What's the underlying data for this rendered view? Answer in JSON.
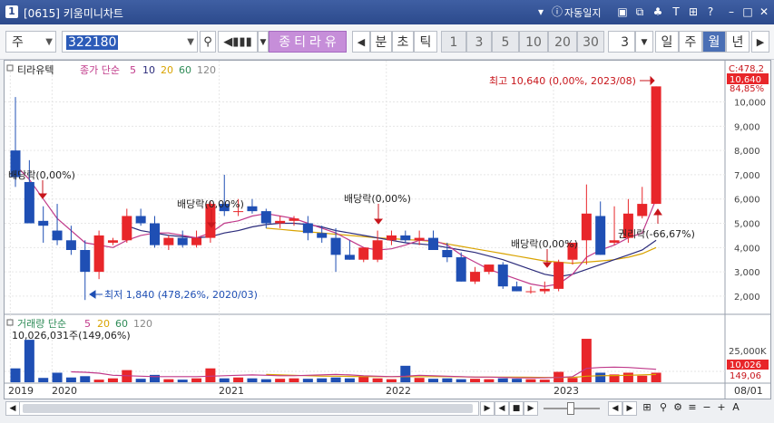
{
  "window": {
    "code": "[0615]",
    "title": "키움미니차트",
    "auto_log": "자동일지",
    "num_badge": "1"
  },
  "toolbar": {
    "market": "주",
    "code": "322180",
    "name_chars": [
      "티",
      "라",
      "유"
    ],
    "name_prefix": "종",
    "period_buttons": [
      "분",
      "초",
      "틱"
    ],
    "interval_buttons": [
      "1",
      "3",
      "5",
      "10",
      "20",
      "30"
    ],
    "interval_value": "3",
    "cycle_buttons": [
      "일",
      "주",
      "월",
      "년"
    ],
    "selected_cycle": "월"
  },
  "legend": {
    "stock_name": "티라유텍",
    "ma_label": "종가 단순",
    "ma_periods": [
      {
        "label": "5",
        "color": "#c0398a"
      },
      {
        "label": "10",
        "color": "#2a2a7a"
      },
      {
        "label": "20",
        "color": "#d9a300"
      },
      {
        "label": "60",
        "color": "#2e8b57"
      },
      {
        "label": "120",
        "color": "#888888"
      }
    ],
    "vol_label": "거래량 단순",
    "vol_periods": [
      {
        "label": "5",
        "color": "#c0398a"
      },
      {
        "label": "20",
        "color": "#d9a300"
      },
      {
        "label": "60",
        "color": "#2e8b57"
      },
      {
        "label": "120",
        "color": "#888888"
      }
    ],
    "vol_max_text": "10,026,031주(149,06%)"
  },
  "annotations": {
    "high": "최고 10,640 (0,00%, 2023/08)",
    "low": "최저 1,840 (478,26%, 2020/03)",
    "dividends": [
      "배당락(0,00%)",
      "배당락(0,00%)",
      "배당락(0,00%)",
      "배당락(0,00%)"
    ],
    "rights": "권리락(-66,67%)"
  },
  "price_axis": {
    "ticks": [
      "10,000",
      "9,000",
      "8,000",
      "7,000",
      "6,000",
      "5,000",
      "4,000",
      "3,000",
      "2,000"
    ],
    "current_badge": "10,640",
    "top_badge": "C:478,2",
    "second_badge": "84,85%"
  },
  "volume_axis": {
    "tick": "25,000K",
    "badge1": "10,026",
    "badge2": "149,06"
  },
  "time_axis": {
    "labels": [
      "2019",
      "2020",
      "2021",
      "2022",
      "2023"
    ],
    "right_label": "08/01"
  },
  "chart_data": {
    "type": "candlestick",
    "title": "티라유텍",
    "x_unit": "month",
    "y_range": [
      1400,
      11400
    ],
    "candles": [
      {
        "o": 8000,
        "h": 10200,
        "l": 6500,
        "c": 6900
      },
      {
        "o": 6700,
        "h": 7600,
        "l": 5300,
        "c": 5000
      },
      {
        "o": 5100,
        "h": 5700,
        "l": 4200,
        "c": 4900
      },
      {
        "o": 4700,
        "h": 5800,
        "l": 4100,
        "c": 4300
      },
      {
        "o": 4300,
        "h": 4900,
        "l": 3700,
        "c": 3900
      },
      {
        "o": 3900,
        "h": 4300,
        "l": 1840,
        "c": 3000
      },
      {
        "o": 3000,
        "h": 4700,
        "l": 2700,
        "c": 4500
      },
      {
        "o": 4200,
        "h": 4400,
        "l": 4100,
        "c": 4300
      },
      {
        "o": 4300,
        "h": 5600,
        "l": 4200,
        "c": 5300
      },
      {
        "o": 5300,
        "h": 5600,
        "l": 4900,
        "c": 5000
      },
      {
        "o": 5000,
        "h": 5300,
        "l": 4000,
        "c": 4100
      },
      {
        "o": 4100,
        "h": 4500,
        "l": 3900,
        "c": 4400
      },
      {
        "o": 4400,
        "h": 4700,
        "l": 4000,
        "c": 4100
      },
      {
        "o": 4100,
        "h": 4700,
        "l": 4000,
        "c": 4400
      },
      {
        "o": 4400,
        "h": 5900,
        "l": 4200,
        "c": 5800
      },
      {
        "o": 5800,
        "h": 7000,
        "l": 5300,
        "c": 5500
      },
      {
        "o": 5500,
        "h": 6000,
        "l": 5300,
        "c": 5500
      },
      {
        "o": 5700,
        "h": 6000,
        "l": 5400,
        "c": 5500
      },
      {
        "o": 5500,
        "h": 5600,
        "l": 4800,
        "c": 5000
      },
      {
        "o": 5000,
        "h": 5300,
        "l": 4800,
        "c": 5100
      },
      {
        "o": 5100,
        "h": 5300,
        "l": 4900,
        "c": 5200
      },
      {
        "o": 5000,
        "h": 5300,
        "l": 4300,
        "c": 4600
      },
      {
        "o": 4600,
        "h": 4900,
        "l": 4200,
        "c": 4400
      },
      {
        "o": 4400,
        "h": 4800,
        "l": 3000,
        "c": 3700
      },
      {
        "o": 3700,
        "h": 4300,
        "l": 3500,
        "c": 3500
      },
      {
        "o": 3500,
        "h": 4000,
        "l": 3400,
        "c": 4000
      },
      {
        "o": 3500,
        "h": 4700,
        "l": 3400,
        "c": 4300
      },
      {
        "o": 4300,
        "h": 4700,
        "l": 4100,
        "c": 4500
      },
      {
        "o": 4500,
        "h": 4700,
        "l": 4200,
        "c": 4300
      },
      {
        "o": 4300,
        "h": 4700,
        "l": 4100,
        "c": 4400
      },
      {
        "o": 4400,
        "h": 4700,
        "l": 3900,
        "c": 3900
      },
      {
        "o": 3900,
        "h": 4200,
        "l": 3400,
        "c": 3600
      },
      {
        "o": 3600,
        "h": 3800,
        "l": 2600,
        "c": 2600
      },
      {
        "o": 2600,
        "h": 3200,
        "l": 2500,
        "c": 3000
      },
      {
        "o": 3000,
        "h": 3300,
        "l": 2900,
        "c": 3300
      },
      {
        "o": 3300,
        "h": 3400,
        "l": 2300,
        "c": 2400
      },
      {
        "o": 2400,
        "h": 2600,
        "l": 2200,
        "c": 2200
      },
      {
        "o": 2200,
        "h": 2400,
        "l": 2100,
        "c": 2200
      },
      {
        "o": 2200,
        "h": 2600,
        "l": 2100,
        "c": 2300
      },
      {
        "o": 2300,
        "h": 3500,
        "l": 2200,
        "c": 3400
      },
      {
        "o": 3500,
        "h": 4200,
        "l": 3300,
        "c": 4200
      },
      {
        "o": 4300,
        "h": 6600,
        "l": 3300,
        "c": 5400
      },
      {
        "o": 5300,
        "h": 5900,
        "l": 3700,
        "c": 3700
      },
      {
        "o": 4200,
        "h": 5700,
        "l": 4100,
        "c": 4300
      },
      {
        "o": 4400,
        "h": 6000,
        "l": 4200,
        "c": 5400
      },
      {
        "o": 5300,
        "h": 6500,
        "l": 5200,
        "c": 5800
      },
      {
        "o": 5800,
        "h": 10640,
        "l": 5800,
        "c": 10640
      }
    ],
    "volumes": [
      3200,
      9800,
      1000,
      2200,
      1100,
      1400,
      600,
      900,
      2800,
      800,
      1700,
      700,
      600,
      900,
      3200,
      900,
      1100,
      900,
      700,
      800,
      900,
      800,
      900,
      1100,
      900,
      1400,
      900,
      700,
      3800,
      1000,
      800,
      900,
      700,
      800,
      700,
      900,
      800,
      700,
      600,
      2400,
      1000,
      10026,
      2200,
      1800,
      2200,
      1500,
      2200
    ],
    "volume_range": [
      0,
      11500
    ],
    "ma5": [
      7400,
      6800,
      6000,
      5200,
      4700,
      4200,
      4100,
      4000,
      4300,
      4500,
      4600,
      4600,
      4500,
      4400,
      4600,
      5000,
      5100,
      5300,
      5400,
      5300,
      5200,
      5000,
      4800,
      4600,
      4300,
      4000,
      3900,
      3950,
      4100,
      4300,
      4300,
      4100,
      3700,
      3400,
      3100,
      2900,
      2700,
      2500,
      2400,
      2500,
      2900,
      3600,
      3900,
      4100,
      4400,
      4600,
      6000
    ],
    "ma10": [
      null,
      null,
      null,
      null,
      null,
      null,
      null,
      null,
      4900,
      4700,
      4600,
      4500,
      4450,
      4400,
      4450,
      4600,
      4700,
      4850,
      4950,
      5000,
      5000,
      4950,
      4850,
      4700,
      4600,
      4500,
      4400,
      4300,
      4200,
      4150,
      4100,
      4000,
      3900,
      3800,
      3650,
      3500,
      3300,
      3100,
      2900,
      2800,
      2900,
      3100,
      3300,
      3500,
      3700,
      3900,
      4300
    ],
    "ma20": [
      null,
      null,
      null,
      null,
      null,
      null,
      null,
      null,
      null,
      null,
      null,
      null,
      null,
      null,
      null,
      null,
      null,
      null,
      4800,
      4750,
      4700,
      4650,
      4600,
      4550,
      4500,
      4450,
      4400,
      4370,
      4330,
      4300,
      4250,
      4150,
      4050,
      3950,
      3850,
      3750,
      3650,
      3550,
      3450,
      3400,
      3350,
      3400,
      3450,
      3500,
      3600,
      3750,
      4000
    ],
    "vol_ma5": [
      null,
      null,
      null,
      null,
      2400,
      2300,
      2100,
      1600,
      1500,
      1400,
      1300,
      1300,
      1300,
      1300,
      1400,
      1500,
      1600,
      1700,
      1600,
      1500,
      1500,
      1600,
      1700,
      1800,
      1700,
      1500,
      1400,
      1300,
      1400,
      1600,
      1500,
      1400,
      1300,
      1200,
      1200,
      1100,
      1000,
      1000,
      1000,
      1100,
      1300,
      3200,
      3400,
      3500,
      3400,
      3200,
      3000
    ],
    "vol_ma20": [
      null,
      null,
      null,
      null,
      null,
      null,
      null,
      null,
      null,
      null,
      null,
      null,
      null,
      null,
      null,
      null,
      null,
      null,
      1800,
      1700,
      1600,
      1500,
      1400,
      1400,
      1350,
      1300,
      1300,
      1300,
      1300,
      1300,
      1300,
      1300,
      1250,
      1200,
      1200,
      1200,
      1200,
      1150,
      1100,
      1100,
      1100,
      1400,
      1500,
      1550,
      1600,
      1700,
      1800
    ],
    "colors": {
      "up": "#e8262a",
      "down": "#1f4fb4"
    }
  }
}
